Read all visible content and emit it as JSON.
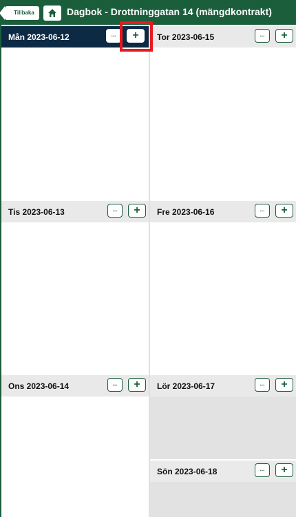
{
  "header": {
    "back_label": "Tillbaka",
    "title": "Dagbok - Drottninggatan 14 (mängdkontrakt)"
  },
  "days": [
    {
      "label": "Mån 2023-06-12",
      "more": "...",
      "add": "+"
    },
    {
      "label": "Tis 2023-06-13",
      "more": "...",
      "add": "+"
    },
    {
      "label": "Ons 2023-06-14",
      "more": "...",
      "add": "+"
    },
    {
      "label": "Tor 2023-06-15",
      "more": "...",
      "add": "+"
    },
    {
      "label": "Fre 2023-06-16",
      "more": "...",
      "add": "+"
    },
    {
      "label": "Lör 2023-06-17",
      "more": "...",
      "add": "+"
    },
    {
      "label": "Sön 2023-06-18",
      "more": "...",
      "add": "+"
    }
  ],
  "colors": {
    "brand": "#1b5e3c",
    "active_day": "#0c2a44",
    "highlight": "#e8191f"
  }
}
